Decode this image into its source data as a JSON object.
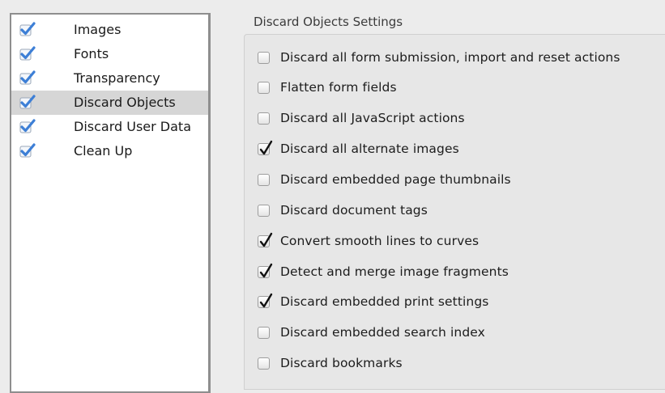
{
  "sidebar": {
    "items": [
      {
        "label": "Images",
        "checked": true,
        "selected": false
      },
      {
        "label": "Fonts",
        "checked": true,
        "selected": false
      },
      {
        "label": "Transparency",
        "checked": true,
        "selected": false
      },
      {
        "label": "Discard Objects",
        "checked": true,
        "selected": true
      },
      {
        "label": "Discard User Data",
        "checked": true,
        "selected": false
      },
      {
        "label": "Clean Up",
        "checked": true,
        "selected": false
      }
    ]
  },
  "settings": {
    "title": "Discard Objects Settings",
    "options": [
      {
        "label": "Discard all form submission, import and reset actions",
        "checked": false
      },
      {
        "label": "Flatten form fields",
        "checked": false
      },
      {
        "label": "Discard all JavaScript actions",
        "checked": false
      },
      {
        "label": "Discard all alternate images",
        "checked": true
      },
      {
        "label": "Discard embedded page thumbnails",
        "checked": false
      },
      {
        "label": "Discard document tags",
        "checked": false
      },
      {
        "label": "Convert smooth lines to curves",
        "checked": true
      },
      {
        "label": "Detect and merge image fragments",
        "checked": true
      },
      {
        "label": "Discard embedded print settings",
        "checked": true
      },
      {
        "label": "Discard embedded search index",
        "checked": false
      },
      {
        "label": "Discard bookmarks",
        "checked": false
      }
    ]
  },
  "icons": {
    "sidebar_check": "blue-checkmark-icon",
    "option_check": "checkmark-icon"
  },
  "colors": {
    "sidebar_check_blue": "#3d7fd6",
    "selected_row": "#d6d6d6"
  }
}
